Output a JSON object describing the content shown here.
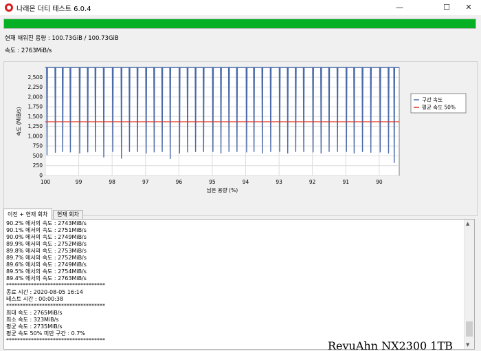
{
  "window": {
    "title": "나래온 더티 테스트 6.0.4",
    "min_glyph": "—",
    "max_glyph": "☐",
    "close_glyph": "✕"
  },
  "progress": {
    "value_percent": 100,
    "color": "#06b025"
  },
  "status": {
    "capacity": "현재 채워진 용량 : 100.73GiB / 100.73GiB",
    "speed": "속도 : 2763MiB/s"
  },
  "chart_data": {
    "type": "line",
    "ylabel": "속도 (MiB/s)",
    "xlabel": "남은 용량 (%)",
    "xlim": [
      100,
      89.4
    ],
    "ylim": [
      0,
      2750
    ],
    "x_ticks": [
      "100",
      "99",
      "98",
      "97",
      "96",
      "95",
      "94",
      "93",
      "92",
      "91",
      "90"
    ],
    "y_ticks": [
      "0",
      "250",
      "500",
      "750",
      "1,000",
      "1,250",
      "1,500",
      "1,750",
      "2,000",
      "2,250",
      "2,500"
    ],
    "grid": true,
    "legend_position": "right",
    "series": [
      {
        "name": "구간 속도",
        "color": "#4a6aa8",
        "baseline": 2750,
        "dips": [
          [
            99.95,
            520
          ],
          [
            99.7,
            580
          ],
          [
            99.48,
            600
          ],
          [
            99.25,
            590
          ],
          [
            98.97,
            560
          ],
          [
            98.73,
            590
          ],
          [
            98.5,
            600
          ],
          [
            98.25,
            460
          ],
          [
            97.98,
            600
          ],
          [
            97.72,
            430
          ],
          [
            97.48,
            600
          ],
          [
            97.24,
            600
          ],
          [
            96.98,
            560
          ],
          [
            96.74,
            590
          ],
          [
            96.5,
            600
          ],
          [
            96.26,
            420
          ],
          [
            95.98,
            560
          ],
          [
            95.74,
            590
          ],
          [
            95.5,
            600
          ],
          [
            95.26,
            600
          ],
          [
            94.98,
            600
          ],
          [
            94.74,
            560
          ],
          [
            94.5,
            600
          ],
          [
            94.26,
            600
          ],
          [
            93.97,
            590
          ],
          [
            93.75,
            600
          ],
          [
            93.5,
            560
          ],
          [
            93.25,
            600
          ],
          [
            92.98,
            600
          ],
          [
            92.74,
            560
          ],
          [
            92.5,
            600
          ],
          [
            92.26,
            600
          ],
          [
            91.98,
            590
          ],
          [
            91.74,
            560
          ],
          [
            91.5,
            600
          ],
          [
            91.25,
            600
          ],
          [
            90.98,
            600
          ],
          [
            90.75,
            560
          ],
          [
            90.5,
            600
          ],
          [
            90.25,
            580
          ],
          [
            89.97,
            590
          ],
          [
            89.72,
            560
          ],
          [
            89.55,
            320
          ]
        ]
      },
      {
        "name": "평균 속도 50%",
        "color": "#e0301e",
        "value": 1367
      }
    ]
  },
  "tabs": [
    "이전 + 현재 회차",
    "현재 회차"
  ],
  "log": [
    "90.2% 에서의 속도 : 2743MiB/s",
    "90.1% 에서의 속도 : 2751MiB/s",
    "90.0% 에서의 속도 : 2749MiB/s",
    "89.9% 에서의 속도 : 2752MiB/s",
    "89.8% 에서의 속도 : 2753MiB/s",
    "89.7% 에서의 속도 : 2752MiB/s",
    "89.6% 에서의 속도 : 2749MiB/s",
    "89.5% 에서의 속도 : 2754MiB/s",
    "89.4% 에서의 속도 : 2763MiB/s",
    "************************************",
    "종료 시간 : 2020-08-05 16:14",
    "테스트 시간 : 00:00:38",
    "************************************",
    "최대 속도 : 2765MiB/s",
    "최소 속도 : 323MiB/s",
    "평균 속도 : 2735MiB/s",
    "평균 속도 50% 미만 구간 : 0.7%",
    "************************************"
  ],
  "scrollbar": {
    "up_glyph": "▲",
    "down_glyph": "▼"
  },
  "watermark": "RevuAhn NX2300 1TB"
}
